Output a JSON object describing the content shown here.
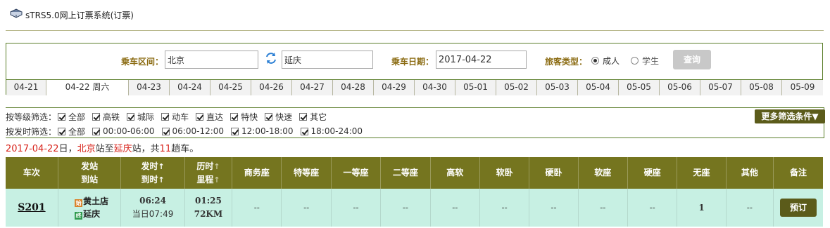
{
  "app": {
    "title": "sTRS5.0网上订票系统(订票)"
  },
  "search": {
    "route_label": "乘车区间：",
    "from": "北京",
    "to": "延庆",
    "date_label": "乘车日期：",
    "date": "2017-04-22",
    "passenger_label": "旅客类型：",
    "passenger_adult": "成人",
    "passenger_student": "学生",
    "query_button": "查询"
  },
  "date_tabs": [
    "04-21",
    "04-22 周六",
    "04-23",
    "04-24",
    "04-25",
    "04-26",
    "04-27",
    "04-28",
    "04-29",
    "04-30",
    "05-01",
    "05-02",
    "05-03",
    "05-04",
    "05-05",
    "05-06",
    "05-07",
    "05-08",
    "05-09"
  ],
  "filters": {
    "grade_label": "按等级筛选：",
    "grade_options": [
      "全部",
      "高铁",
      "城际",
      "动车",
      "直达",
      "特快",
      "快速",
      "其它"
    ],
    "time_label": "按发时筛选：",
    "time_options": [
      "全部",
      "00:00-06:00",
      "06:00-12:00",
      "12:00-18:00",
      "18:00-24:00"
    ],
    "more_button": "更多筛选条件▼"
  },
  "summary": {
    "date": "2017-04-22",
    "t1": "日，",
    "from": "北京",
    "t2": "站至",
    "to": "延庆",
    "t3": "站，共",
    "count": "11",
    "t4": "趟车。"
  },
  "table": {
    "headers": {
      "train": "车次",
      "depart_station": "发站",
      "arrive_station": "到站",
      "depart_time": "发时",
      "arrive_time": "到时",
      "duration": "历时",
      "distance": "里程",
      "business": "商务座",
      "special": "特等座",
      "first": "一等座",
      "second": "二等座",
      "soft_premium": "高软",
      "soft_sleeper": "软卧",
      "hard_sleeper": "硬卧",
      "soft_seat": "软座",
      "hard_seat": "硬座",
      "standing": "无座",
      "other": "其他",
      "remark": "备注"
    },
    "sort_arrow": "↑",
    "rows": [
      {
        "train": "S201",
        "from_badge": "始",
        "from": "黄土店",
        "to_badge": "终",
        "to": "延庆",
        "depart": "06:24",
        "arrive": "当日07:49",
        "duration": "01:25",
        "distance": "72KM",
        "business": "--",
        "special": "--",
        "first": "--",
        "second": "--",
        "soft_premium": "--",
        "soft_sleeper": "--",
        "hard_sleeper": "--",
        "soft_seat": "--",
        "hard_seat": "--",
        "standing": "1",
        "other": "--",
        "book": "预订"
      }
    ]
  }
}
